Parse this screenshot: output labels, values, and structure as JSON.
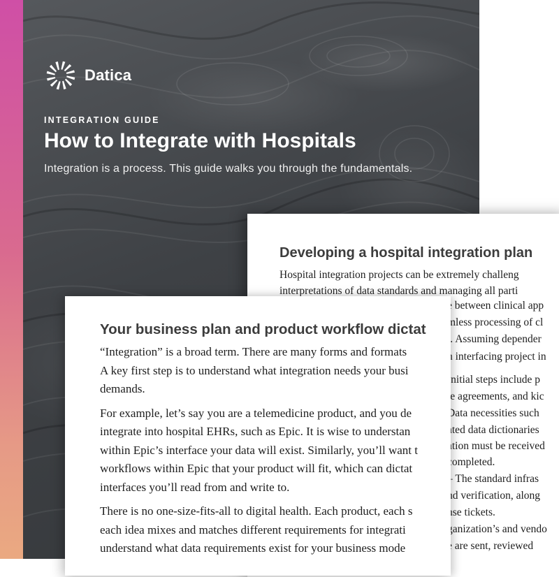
{
  "brand": {
    "name": "Datica",
    "accent_gradient": [
      "#cf4fa6",
      "#eaa981"
    ]
  },
  "cover": {
    "eyebrow": "INTEGRATION GUIDE",
    "title": "How to Integrate with Hospitals",
    "subtitle": "Integration is a process. This guide walks you through the fundamentals.",
    "background_color": "#3e4145"
  },
  "back_page": {
    "title": "Developing a hospital integration plan",
    "lines": [
      "Hospital integration projects can be extremely challeng",
      "interpretations of data standards and managing all parti"
    ],
    "fragments": [
      "e between clinical app",
      "mless processing of cl",
      "t. Assuming depender",
      "n interfacing project in",
      "",
      "Initial steps include p",
      "te agreements, and kic",
      "",
      "Data necessities such",
      "ated data dictionaries",
      "ation must be received",
      "completed.",
      "",
      "– The standard infras",
      "nd verification, along",
      "nse tickets.",
      "",
      "ganization’s and vendo",
      "",
      "e are sent, reviewed"
    ]
  },
  "front_page": {
    "title": "Your business plan and product workflow dictat",
    "paragraphs": [
      [
        "“Integration” is a broad term. There are many forms and formats",
        "A key first step is to understand what integration needs your busi",
        "demands."
      ],
      [
        "For example, let’s say you are a telemedicine product, and you de",
        "integrate into hospital EHRs, such as Epic. It is wise to understan",
        "within Epic’s interface your data will exist. Similarly, you’ll want t",
        "workflows within Epic that your product will fit, which can dictat",
        "interfaces you’ll read from and write to."
      ],
      [
        "There is no one-size-fits-all to digital health. Each product, each s",
        "each idea mixes and matches different requirements for integrati",
        "understand what data requirements exist for your business mode"
      ]
    ]
  }
}
